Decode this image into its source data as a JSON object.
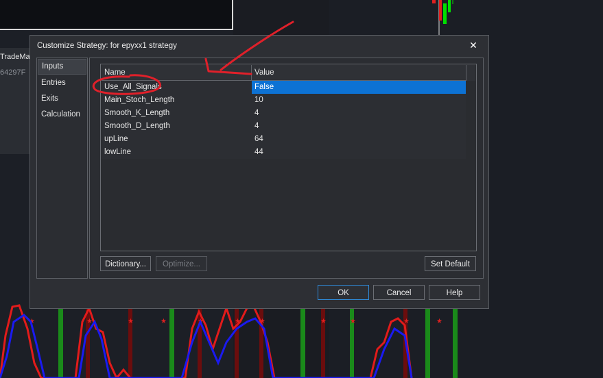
{
  "background": {
    "left_text_1": "TradeMan",
    "left_text_2": "64297F"
  },
  "dialog": {
    "title": "Customize Strategy: for epyxx1 strategy",
    "close_label": "✕",
    "nav": [
      "Inputs",
      "Entries",
      "Exits",
      "Calculation"
    ],
    "selected_nav": "Inputs",
    "grid": {
      "columns": [
        "Name",
        "Value"
      ],
      "rows": [
        {
          "name": "Use_All_Signals",
          "value": "False"
        },
        {
          "name": "Main_Stoch_Length",
          "value": "10"
        },
        {
          "name": "Smooth_K_Length",
          "value": "4"
        },
        {
          "name": "Smooth_D_Length",
          "value": "4"
        },
        {
          "name": "upLine",
          "value": "64"
        },
        {
          "name": "lowLine",
          "value": "44"
        }
      ],
      "selected_row": 0
    },
    "buttons": {
      "dictionary": "Dictionary...",
      "optimize": "Optimize...",
      "set_default": "Set Default",
      "ok": "OK",
      "cancel": "Cancel",
      "help": "Help"
    }
  },
  "colors": {
    "accent": "#0d72d4",
    "annotation": "#e0202a",
    "dialog_bg": "#2d2f34"
  },
  "annotation": {
    "type": "hand-drawn arrow and circle",
    "target": "Use_All_Signals"
  }
}
